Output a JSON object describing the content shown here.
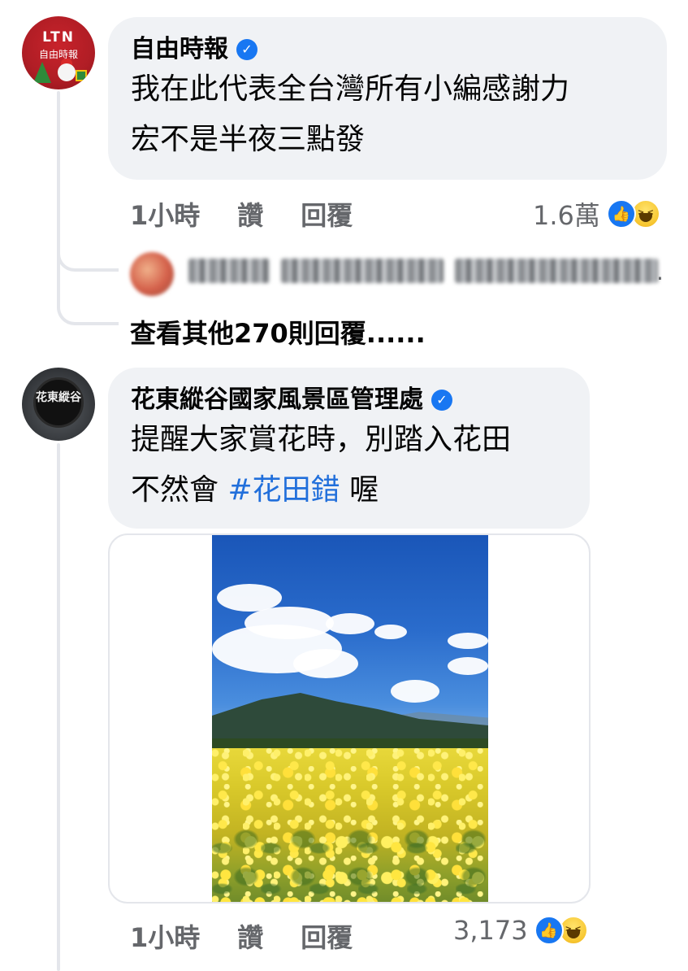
{
  "comments": [
    {
      "author": "自由時報",
      "avatar_text": "LTN",
      "avatar_subtext": "自由時報",
      "verified": true,
      "text_line_1": "我在此代表全台灣所有小編感謝力",
      "text_line_2": "宏不是半夜三點發",
      "time": "1小時",
      "like_label": "讚",
      "reply_label": "回覆",
      "reaction_count": "1.6萬",
      "reactions": [
        "like-icon",
        "haha-icon"
      ],
      "view_more_replies": "查看其他270則回覆......"
    },
    {
      "author": "花東縱谷國家風景區管理處",
      "avatar_text": "花東縱谷",
      "verified": true,
      "text_line_1": "提醒大家賞花時，別踏入花田",
      "text_line_2_prefix": "不然會",
      "hashtag": "#花田錯",
      "text_line_2_suffix": "喔",
      "time": "1小時",
      "like_label": "讚",
      "reply_label": "回覆",
      "reaction_count": "3,173",
      "reactions": [
        "like-icon",
        "haha-icon"
      ],
      "attachment": "canola-field-photo"
    }
  ],
  "reply_preview": {
    "ellipsis": "."
  },
  "colors": {
    "bubble": "#f0f2f5",
    "meta_text": "#65676b",
    "hashtag": "#216fdb",
    "verified": "#1877f2"
  }
}
